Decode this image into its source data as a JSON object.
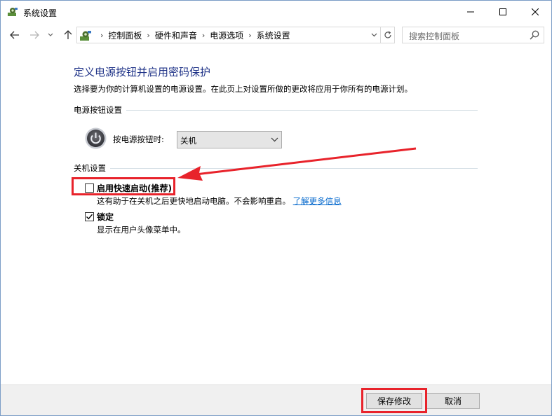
{
  "window": {
    "title": "系统设置"
  },
  "titlebar": {
    "buttons": [
      {
        "name": "minimize-icon"
      },
      {
        "name": "maximize-icon"
      },
      {
        "name": "close-icon"
      }
    ]
  },
  "nav": {
    "breadcrumbs": [
      "控制面板",
      "硬件和声音",
      "电源选项",
      "系统设置"
    ],
    "search_placeholder": "搜索控制面板"
  },
  "main": {
    "title": "定义电源按钮并启用密码保护",
    "description": "选择要为你的计算机设置的电源设置。在此页上对设置所做的更改将应用于你所有的电源计划。",
    "power_section": {
      "heading": "电源按钮设置",
      "label": "按电源按钮时:",
      "selected": "关机"
    },
    "shutdown_section": {
      "heading": "关机设置",
      "fast_startup": {
        "label": "启用快速启动(推荐)",
        "checked": false,
        "description": "这有助于在关机之后更快地启动电脑。不会影响重启。",
        "link": "了解更多信息"
      },
      "lock": {
        "label": "锁定",
        "checked": true,
        "description": "显示在用户头像菜单中。"
      }
    }
  },
  "footer": {
    "save_label": "保存修改",
    "cancel_label": "取消"
  },
  "colors": {
    "title_blue": "#1e3287",
    "link_blue": "#0066cc",
    "highlight_red": "#e8232b"
  }
}
